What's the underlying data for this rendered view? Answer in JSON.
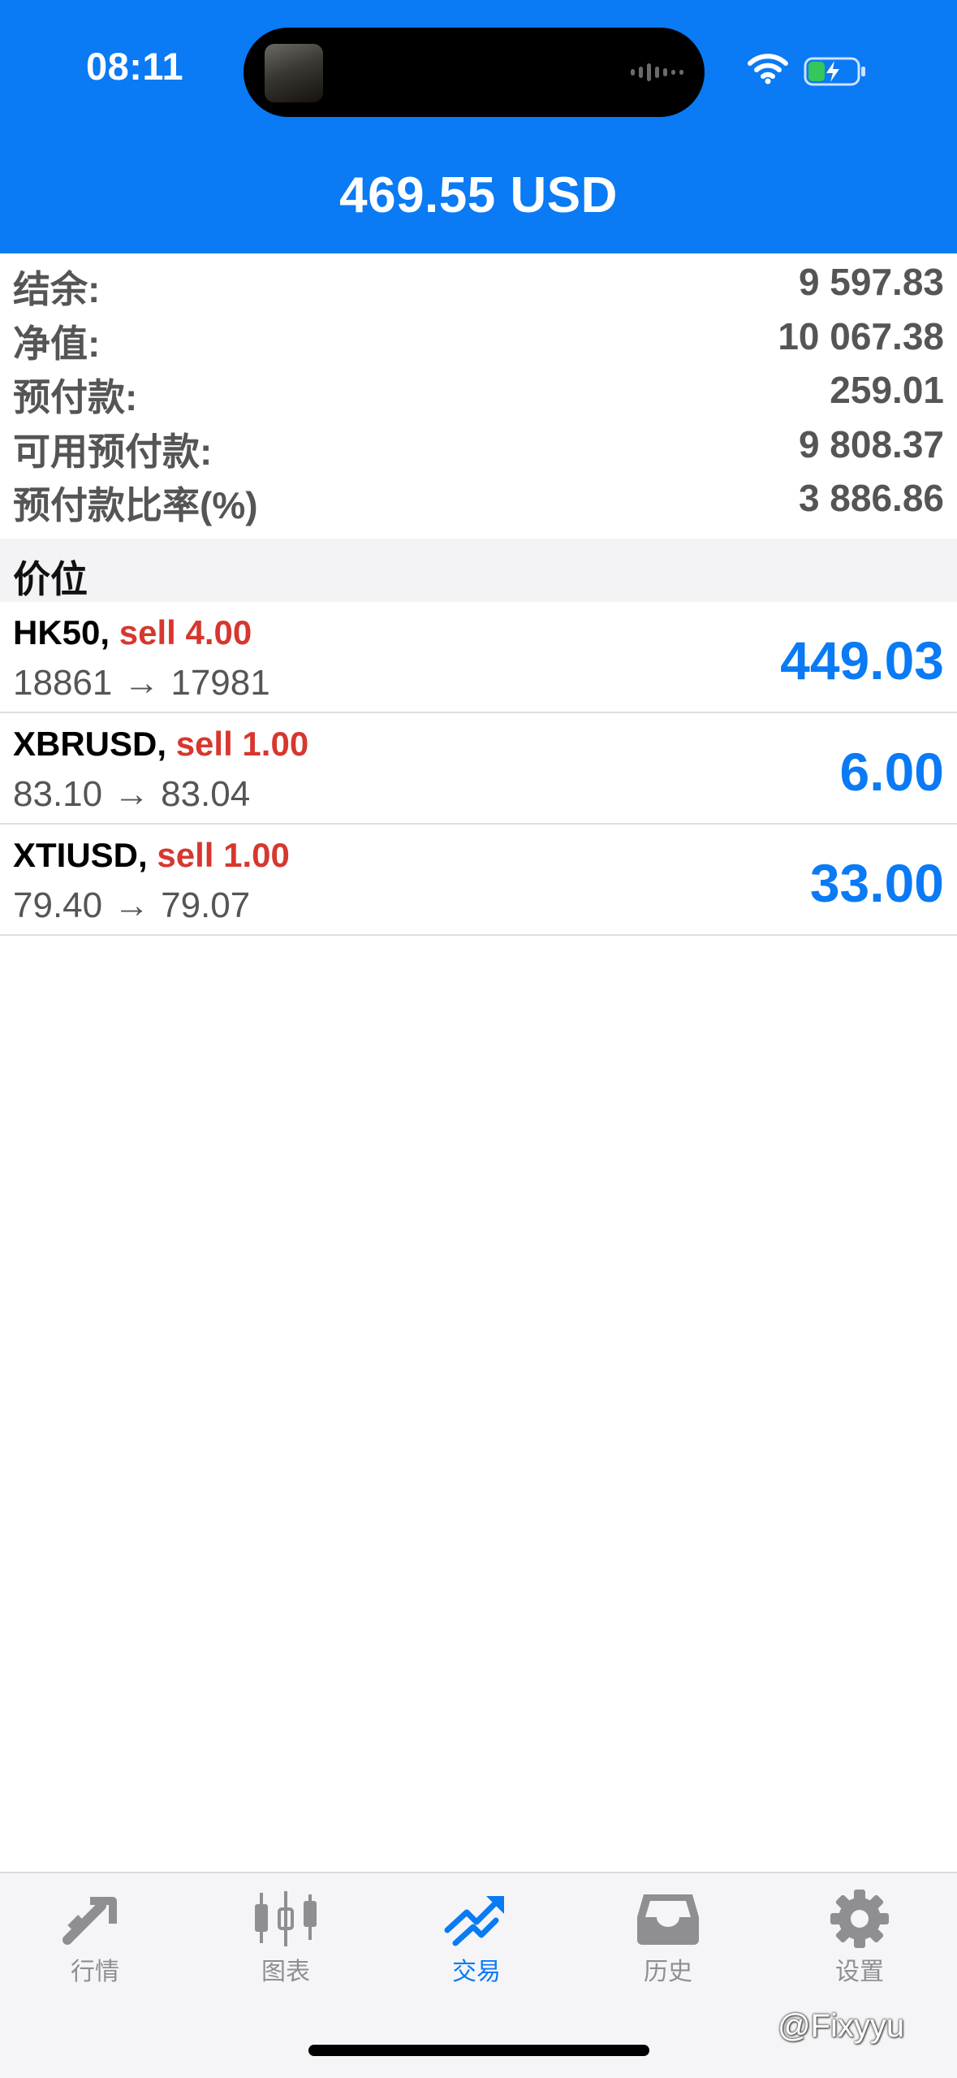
{
  "status_bar": {
    "time": "08:11",
    "icons": [
      "camera-avatar",
      "audio-wave",
      "wifi-icon",
      "battery-charging-icon"
    ]
  },
  "header": {
    "title": "469.55 USD"
  },
  "summary": [
    {
      "label": "结余:",
      "value": "9 597.83"
    },
    {
      "label": "净值:",
      "value": "10 067.38"
    },
    {
      "label": "预付款:",
      "value": "259.01"
    },
    {
      "label": "可用预付款:",
      "value": "9 808.37"
    },
    {
      "label": "预付款比率(%)",
      "value": "3 886.86"
    }
  ],
  "positions_header": "价位",
  "positions": [
    {
      "symbol": "HK50,",
      "side": "sell 4.00",
      "open": "18861",
      "arrow": "→",
      "current": "17981",
      "profit": "449.03"
    },
    {
      "symbol": "XBRUSD,",
      "side": "sell 1.00",
      "open": "83.10",
      "arrow": "→",
      "current": "83.04",
      "profit": "6.00"
    },
    {
      "symbol": "XTIUSD,",
      "side": "sell 1.00",
      "open": "79.40",
      "arrow": "→",
      "current": "79.07",
      "profit": "33.00"
    }
  ],
  "tabs": [
    {
      "label": "行情",
      "icon": "quotes-arrows-icon",
      "active": false
    },
    {
      "label": "图表",
      "icon": "candlestick-chart-icon",
      "active": false
    },
    {
      "label": "交易",
      "icon": "trade-trend-icon",
      "active": true
    },
    {
      "label": "历史",
      "icon": "history-tray-icon",
      "active": false
    },
    {
      "label": "设置",
      "icon": "gear-icon",
      "active": false
    }
  ],
  "watermark": "@Fixyyu",
  "colors": {
    "header_bg": "#0a7af5",
    "profit": "#0a7af5",
    "sell": "#d6372f",
    "tab_active": "#0a7af5",
    "tab_inactive": "#8e8e93"
  }
}
